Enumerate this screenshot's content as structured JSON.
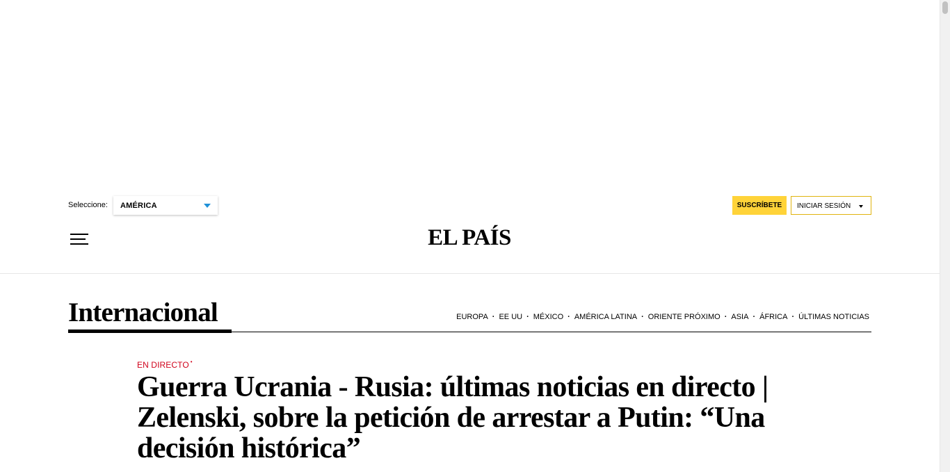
{
  "topbar": {
    "edition_label": "Seleccione:",
    "edition_value": "AMÉRICA",
    "subscribe_label": "SUSCRÍBETE",
    "login_label": "INICIAR SESIÓN"
  },
  "header": {
    "logo": "EL PAÍS"
  },
  "section": {
    "title": "Internacional",
    "nav": [
      "EUROPA",
      "EE UU",
      "MÉXICO",
      "AMÉRICA LATINA",
      "ORIENTE PRÓXIMO",
      "ASIA",
      "ÁFRICA",
      "ÚLTIMAS NOTICIAS"
    ],
    "separator": "·"
  },
  "article": {
    "kicker": "EN DIRECTO",
    "kicker_mark": "•",
    "headline": "Guerra Ucrania - Rusia: últimas noticias en directo | Zelenski, sobre la petición de arrestar a Putin: “Una decisión histórica”"
  },
  "colors": {
    "subscribe_bg": "#ffd339",
    "live_red": "#d0021b",
    "select_caret": "#1e90d8"
  },
  "icons": {
    "menu": "hamburger-menu-icon",
    "edition_caret": "triangle-down-icon",
    "login_caret": "triangle-down-icon"
  }
}
